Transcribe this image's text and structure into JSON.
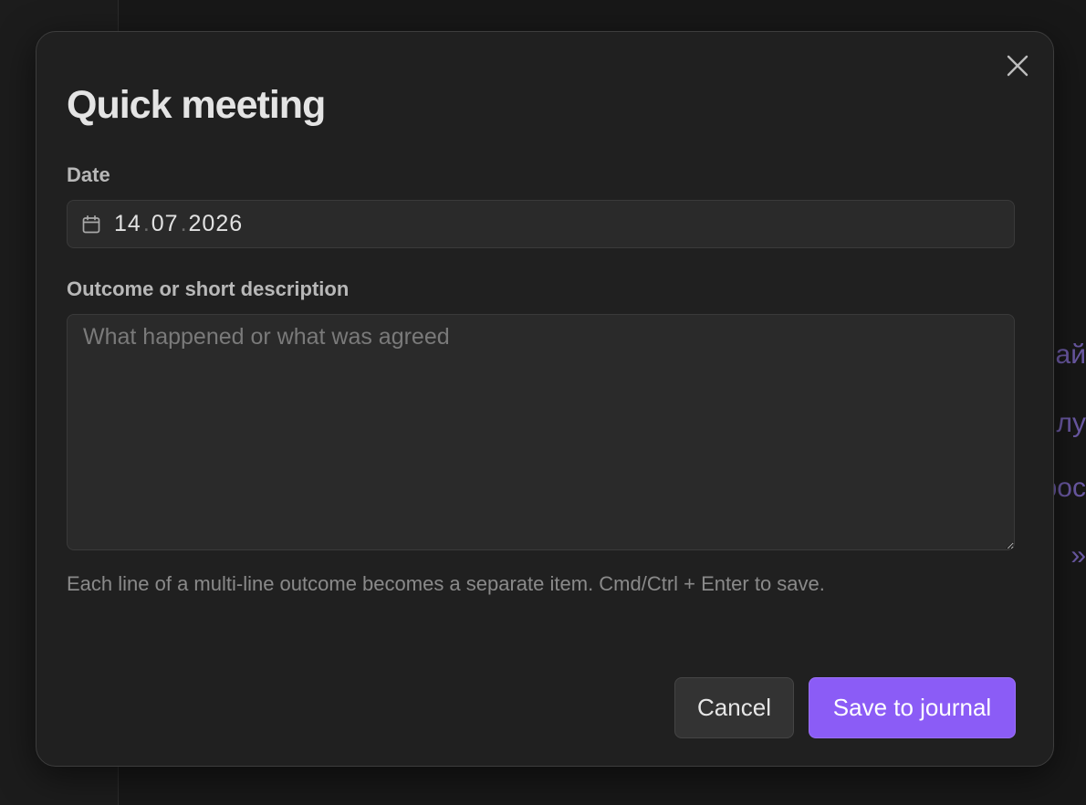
{
  "background": {
    "partial_text": [
      "ай",
      "лу",
      "рос",
      "»"
    ]
  },
  "modal": {
    "title": "Quick meeting",
    "close_icon": "close-icon",
    "date_field": {
      "label": "Date",
      "icon": "calendar-icon",
      "day": "14",
      "month": "07",
      "year": "2026",
      "separator": "."
    },
    "description_field": {
      "label": "Outcome or short description",
      "value": "",
      "placeholder": "What happened or what was agreed"
    },
    "helper_text": "Each line of a multi-line outcome becomes a separate item. Cmd/Ctrl + Enter to save.",
    "buttons": {
      "cancel_label": "Cancel",
      "save_label": "Save to journal"
    }
  },
  "colors": {
    "accent": "#8b5cf6",
    "modal_bg": "#202020",
    "input_bg": "#2a2a2a",
    "background_text": "#6c5aa6"
  }
}
